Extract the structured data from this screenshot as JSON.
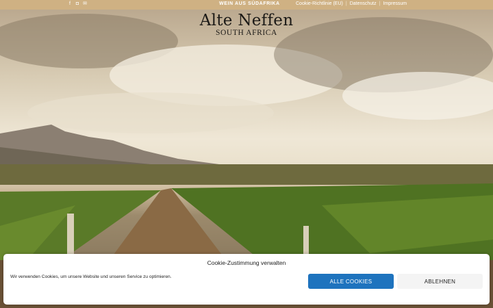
{
  "topbar": {
    "title": "WEIN AUS SÜDAFRIKA",
    "social_icons": [
      "facebook-icon",
      "instagram-icon",
      "mail-icon"
    ],
    "links": [
      "Cookie-Richtlinie (EU)",
      "Datenschutz",
      "Impressum"
    ]
  },
  "logo": {
    "main": "Alte Neffen",
    "sub": "SOUTH AFRICA"
  },
  "cookie": {
    "title": "Cookie-Zustimmung verwalten",
    "text": "Wir verwenden Cookies, um unsere Website und unseren Service zu optimieren.",
    "accept_label": "ALLE COOKIES",
    "deny_label": "ABLEHNEN"
  },
  "colors": {
    "topbar": "#cfb183",
    "accent_button": "#1e73be"
  }
}
